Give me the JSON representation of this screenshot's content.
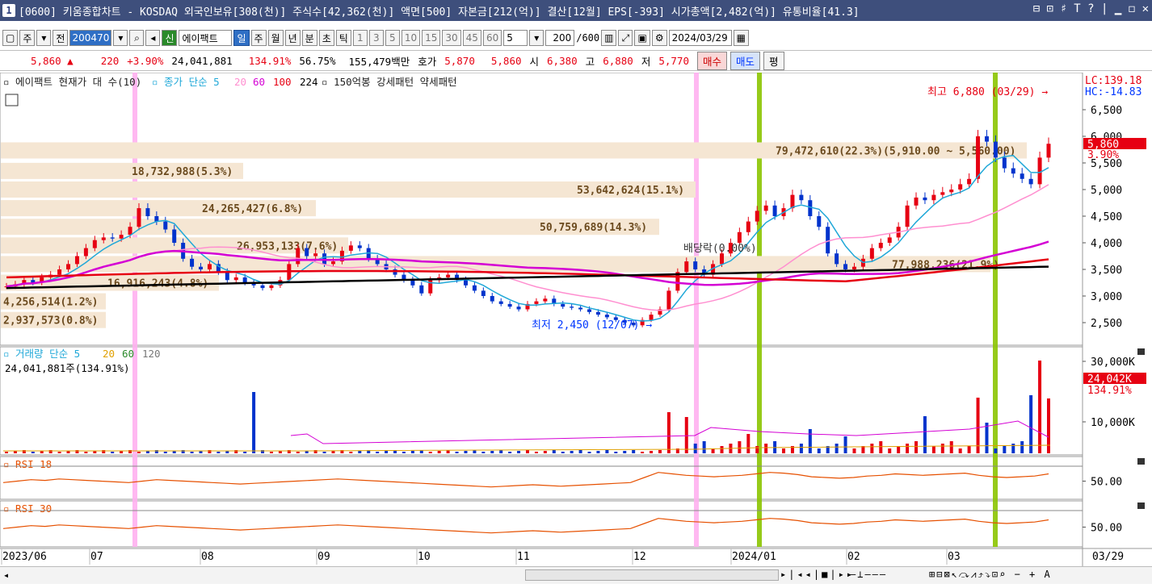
{
  "titlebar": {
    "num": "1",
    "title": "[0600] 키움종합차트 - KOSDAQ 외국인보유[308(천)] 주식수[42,362(천)] 액면[500] 자본금[212(억)] 결산[12월] EPS[-393] 시가총액[2,482(억)] 유통비율[41.3]",
    "controls": "⊟ ⊡ ♯ T ? | ▁ ◻ ✕"
  },
  "toolbar": {
    "week": "주",
    "prev": "전",
    "code": "200470",
    "name": "에이팩트",
    "periods": [
      "일",
      "주",
      "월",
      "년",
      "분",
      "초",
      "틱"
    ],
    "minutes": [
      "1",
      "3",
      "5",
      "10",
      "15",
      "30",
      "45",
      "60"
    ],
    "count_value": "5",
    "range": "200",
    "range_max": "/600",
    "date": "2024/03/29"
  },
  "quote": {
    "price": "5,860 ▲",
    "change": "220",
    "change_pct": "+3.90%",
    "volume": "24,041,881",
    "vol_ratio": "134.91%",
    "turnover": "56.75%",
    "amount": "155,479백만",
    "bid_label": "호가",
    "ask": "5,870",
    "bid": "5,860",
    "open_label": "시",
    "open": "6,380",
    "high_label": "고",
    "high": "6,880",
    "low_label": "저",
    "low": "5,770",
    "buy": "매수",
    "sell": "매도",
    "avg": "평"
  },
  "chart_data": {
    "type": "candlestick",
    "price_legend": "에이팩트 현재가 대 수(10)",
    "ma_label": "종가 단순 5",
    "ma_periods": [
      "5",
      "20",
      "60",
      "100",
      "224"
    ],
    "ma_colors": [
      "#20a8d8",
      "#ff8fd0",
      "#d400d4",
      "#e60012",
      "#000000"
    ],
    "pattern_label": "150억봉 강세패턴 약세패턴",
    "lc": "LC:139.18",
    "hc": "HC:-14.83",
    "price_axis": [
      "6,500",
      "6,000",
      "5,500",
      "5,000",
      "4,500",
      "4,000",
      "3,500",
      "3,000",
      "2,500"
    ],
    "current_price": "5,860",
    "current_pct": "3.90%",
    "high_note": "최고 6,880 (03/29)",
    "low_note": "최저 2,450 (12/07)",
    "dividend_note": "배당락(0.00%)",
    "volume_profile": [
      {
        "label": "79,472,610(22.3%)(5,910.00 ~ 5,560.00)",
        "price": 5735
      },
      {
        "label": "18,732,988(5.3%)",
        "price": 5350
      },
      {
        "label": "53,642,624(15.1%)",
        "price": 5000
      },
      {
        "label": "24,265,427(6.8%)",
        "price": 4650
      },
      {
        "label": "50,759,689(14.3%)",
        "price": 4300
      },
      {
        "label": "26,953,133(7.6%)",
        "price": 3950
      },
      {
        "label": "77,988,236(21.9%)",
        "price": 3600
      },
      {
        "label": "16,916,243(4.8%)",
        "price": 3250
      },
      {
        "label": "4,256,514(1.2%)",
        "price": 2900
      },
      {
        "label": "2,937,573(0.8%)",
        "price": 2550
      }
    ],
    "volume_legend": "거래량 단순 5",
    "volume_periods": [
      "20",
      "60",
      "120"
    ],
    "volume_value": "24,041,881주(134.91%)",
    "volume_axis": [
      "30,000K",
      "10,000K"
    ],
    "volume_current": "24,042K",
    "volume_pct": "134.91%",
    "rsi1_label": "RSI 18",
    "rsi2_label": "RSI 30",
    "rsi_axis": "50.00",
    "x_labels": [
      "2023/06",
      "07",
      "08",
      "09",
      "10",
      "11",
      "12",
      "2024/01",
      "02",
      "03"
    ],
    "x_last": "03/29",
    "close_series": [
      3180,
      3220,
      3300,
      3250,
      3350,
      3400,
      3500,
      3600,
      3750,
      3900,
      4050,
      4100,
      4080,
      4150,
      4300,
      4650,
      4500,
      4400,
      4250,
      4000,
      3700,
      3550,
      3500,
      3600,
      3450,
      3300,
      3350,
      3250,
      3200,
      3150,
      3200,
      3300,
      3600,
      3900,
      3750,
      3800,
      3600,
      3650,
      3850,
      3950,
      3900,
      3700,
      3600,
      3500,
      3400,
      3300,
      3200,
      3050,
      3300,
      3350,
      3400,
      3300,
      3200,
      3100,
      3000,
      2900,
      2850,
      2800,
      2750,
      2850,
      2900,
      2950,
      2850,
      2800,
      2780,
      2750,
      2700,
      2650,
      2600,
      2550,
      2500,
      2450,
      2550,
      2650,
      2750,
      3100,
      3450,
      3650,
      3500,
      3400,
      3600,
      3800,
      4000,
      4200,
      4400,
      4600,
      4700,
      4500,
      4650,
      4900,
      4800,
      4500,
      4300,
      3800,
      3600,
      3500,
      3550,
      3700,
      3900,
      4000,
      4100,
      4300,
      4700,
      4850,
      4800,
      4900,
      4950,
      5000,
      5100,
      5200,
      6000,
      5900,
      5600,
      5400,
      5300,
      5200,
      5100,
      5600,
      5860
    ],
    "rsi18_series": [
      48,
      50,
      52,
      51,
      53,
      52,
      51,
      50,
      49,
      48,
      50,
      52,
      51,
      50,
      49,
      48,
      47,
      46,
      47,
      48,
      49,
      50,
      51,
      52,
      53,
      52,
      51,
      50,
      49,
      48,
      47,
      46,
      45,
      44,
      43,
      42,
      43,
      44,
      45,
      44,
      43,
      44,
      45,
      46,
      47,
      48,
      55,
      62,
      60,
      58,
      57,
      56,
      57,
      58,
      60,
      62,
      61,
      59,
      56,
      55,
      54,
      55,
      57,
      58,
      60,
      59,
      58,
      59,
      60,
      61,
      58,
      56,
      55,
      56,
      57,
      60
    ]
  }
}
